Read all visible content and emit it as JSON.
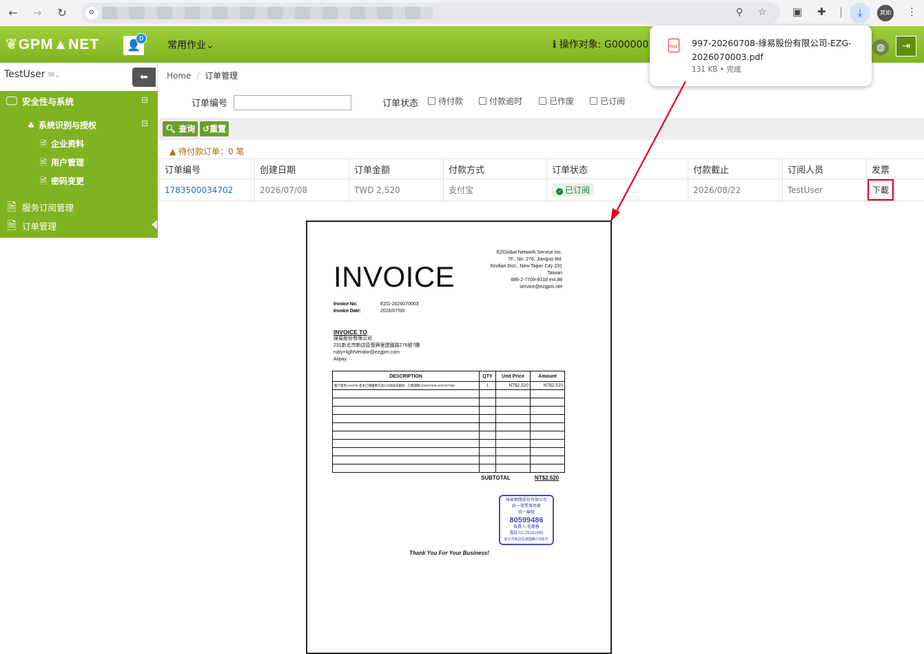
{
  "browser": {
    "download_popup": {
      "file_name": "997-20260708-綠易股份有限公司-EZG-2026070003.pdf",
      "meta": "131 KB • 完成"
    },
    "avatar_text": "其如"
  },
  "header": {
    "logo": "GPM▲NET",
    "user_badge": "0",
    "common_menu": "常用作业",
    "operate_target": "操作对象: G000000"
  },
  "sidebar": {
    "username": "TestUser",
    "items": [
      {
        "label": "安全性与系统",
        "icon": "monitor-icon"
      },
      {
        "label": "系统识别与授权",
        "icon": "users-icon"
      },
      {
        "label": "企业资料",
        "icon": "document-icon"
      },
      {
        "label": "用户管理",
        "icon": "document-icon"
      },
      {
        "label": "密码变更",
        "icon": "document-icon"
      },
      {
        "label": "服务订阅管理",
        "icon": "document-icon"
      },
      {
        "label": "订单管理",
        "icon": "document-icon"
      }
    ]
  },
  "breadcrumb": {
    "home": "Home",
    "current": "订单管理"
  },
  "filters": {
    "order_no_label": "订单编号",
    "order_no_value": "",
    "status_label": "订单状态",
    "statuses": [
      "待付款",
      "付款逾时",
      "已作废",
      "已订阅"
    ]
  },
  "buttons": {
    "search": "查询",
    "reset": "重置"
  },
  "pending_text": "待付款订单：0 笔",
  "table": {
    "headers": [
      "订单编号",
      "创建日期",
      "订单金额",
      "付款方式",
      "订单状态",
      "付款截止",
      "订阅人员",
      "发票"
    ],
    "rows": [
      {
        "order_no": "1783500034702",
        "created": "2026/07/08",
        "amount": "TWD 2,520",
        "payment": "支付宝",
        "status": "已订阅",
        "deadline": "2026/08/22",
        "subscriber": "TestUser",
        "invoice": "下載"
      }
    ]
  },
  "invoice": {
    "title": "INVOICE",
    "company": [
      "EZGlobal Network Service Inc.",
      "7F., No. 276, Jianguo Rd.",
      "Xindian Dist., New Taipei City 231",
      "Taiwan",
      "886-2-7709-9318 ext.88",
      "service@ezgpm.net"
    ],
    "invoice_no_label": "Invoice No:",
    "invoice_no": "EZG-2026070003",
    "invoice_date_label": "Invoice Date:",
    "invoice_date": "2026/07/08",
    "to_label": "INVOICE TO",
    "to_lines": [
      "綠易股份有限公司",
      "231新北市新店區復興里建國路276號7樓",
      "ruby+lightVendor@ezgpm.com",
      "Alipay"
    ],
    "item_headers": [
      "DESCRIPTION",
      "QTY",
      "Unit Price",
      "Amount"
    ],
    "item": {
      "description": "帳戶使用-ezGPM-基本訂閱優惠方案(CR測試未刪除 · 訂閱期間:2026/07/08~2027/07/08)",
      "qty": "1",
      "unit_price": "NT$2,520",
      "amount": "NT$2,520"
    },
    "subtotal_label": "SUBTOTAL",
    "subtotal": "NT$2,520",
    "seal_lines": [
      "綠易網路股份有限公司",
      "統一發票專用章",
      "統一編號",
      "80599486",
      "負責人:毛麗善",
      "電話:02-29161890",
      "新北市新店區建國路276號7F"
    ],
    "thanks": "Thank You For Your Business!"
  }
}
